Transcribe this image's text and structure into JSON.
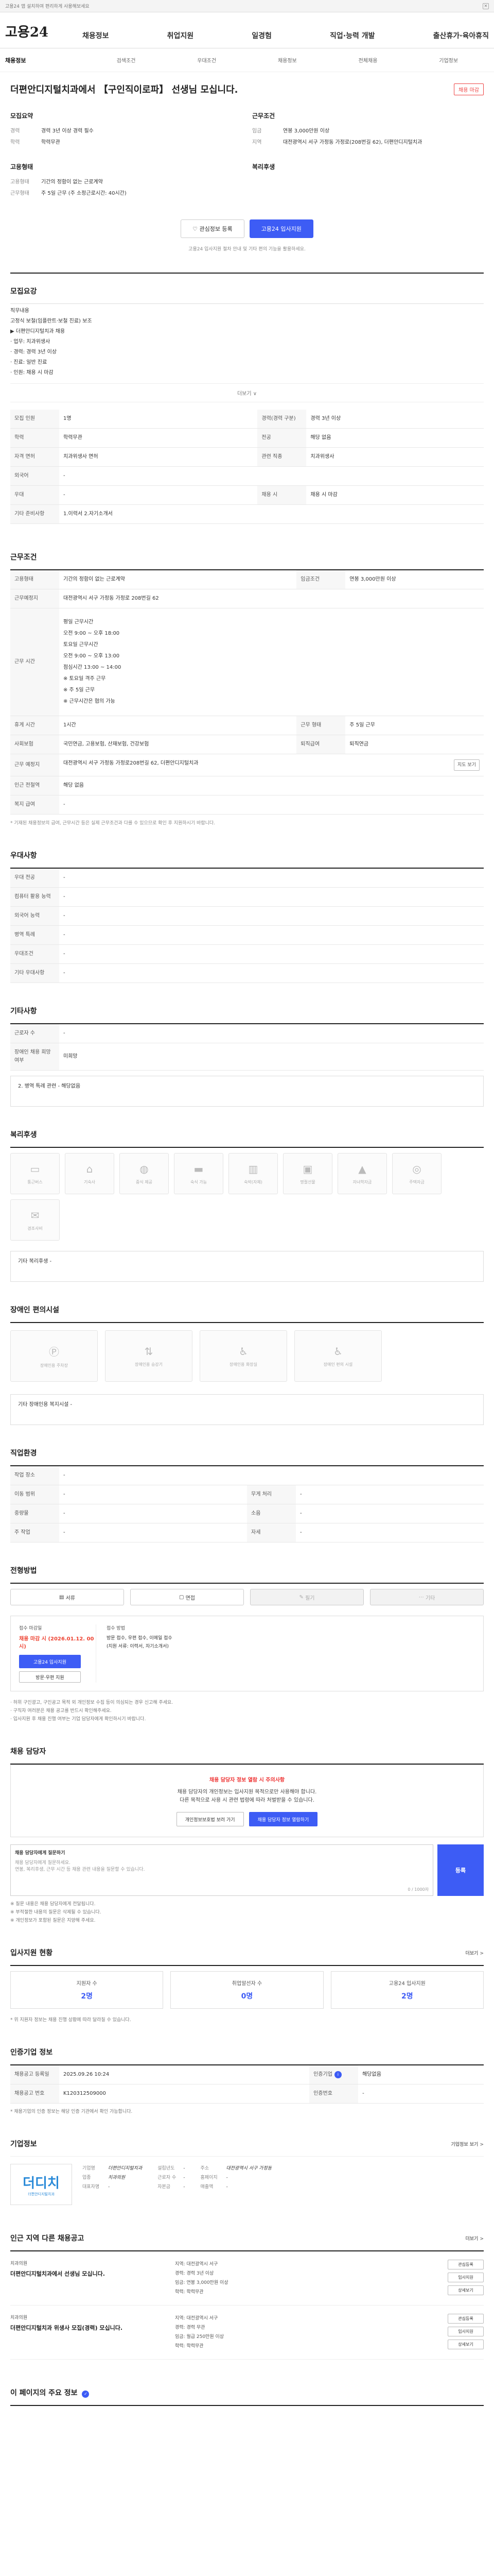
{
  "topbar": {
    "text": "고용24 앱 설치하여 편리하게 사용해보세요",
    "close": "×"
  },
  "header": {
    "logo": "고용24",
    "menu": [
      "채용정보",
      "취업지원",
      "일경험",
      "직업·능력 개발",
      "출산휴가·육아휴직"
    ]
  },
  "subnav": [
    "채용정보",
    "검색조건",
    "우대조건",
    "채용정보",
    "전체채용",
    "기업정보"
  ],
  "job": {
    "title": "더편안디지털치과에서 【구인직이로파】 선생님 모십니다.",
    "status": "채용 마감",
    "recruit_label": "모집요약",
    "cond_label": "근무조건",
    "recruit": [
      {
        "k": "경력",
        "v": "경력 3년 이상 경력 필수"
      },
      {
        "k": "학력",
        "v": "학력무관"
      }
    ],
    "cond": [
      {
        "k": "임금",
        "v": "연봉 3,000만원 이상"
      },
      {
        "k": "지역",
        "v": "대전광역시 서구 가정동 가정로(208번길 62), 더편안디지털치과"
      }
    ],
    "employ_label": "고용형태",
    "welfare_label": "복리후생",
    "employ": [
      {
        "k": "고용형태",
        "v": "기간의 정함이 없는 근로계약"
      },
      {
        "k": "근무형태",
        "v": "주 5일 근무 (주 소정근로시간: 40시간)"
      }
    ],
    "btn_apply_l": "관심정보 등록",
    "btn_apply_r": "고용24 입사지원",
    "notice": "고용24 입사지원 절차 안내 및 기타 편의 기능을 활용하세요."
  },
  "s1": {
    "title": "모집요강",
    "body": [
      "직무내용",
      "고정식 보철(임플란트·보철 진료) 보조",
      "▶ 더편안디지털치과 채용",
      "· 업무: 치과위생사",
      "· 경력: 경력 3년 이상",
      "· 진료: 일반 진료",
      "· 인원: 채용 시 마감"
    ],
    "more": "더보기 ∨",
    "rows": [
      [
        "모집 인원",
        "1명",
        "경력(경력 구분)",
        "경력 3년 이상"
      ],
      [
        "학력",
        "학력무관",
        "전공",
        "해당 없음"
      ],
      [
        "자격 면허",
        "치과위생사 면허",
        "관련 직종",
        "치과위생사"
      ],
      [
        "외국어",
        "-",
        "",
        ""
      ],
      [
        "우대",
        "-",
        "채용 시",
        "채용 시 마감"
      ]
    ],
    "etc_label": "기타 준비사항",
    "etc": "1.이력서 2.자기소개서"
  },
  "s2": {
    "title": "근무조건",
    "rows": [
      [
        "고용형태",
        "기간의 정함이 없는 근로계약",
        "임금조건",
        "연봉 3,000만원 이상"
      ],
      [
        "근무예정지",
        "대전광역시 서구 가정동 가정로 208번길 62",
        "",
        ""
      ]
    ],
    "shift_label": "근무 시간",
    "shift": [
      "평일 근무시간",
      "오전 9:00 ~ 오후 18:00",
      "토요일 근무시간",
      "오전 9:00 ~ 오후 13:00",
      "점심시간 13:00 ~ 14:00",
      "※ 토요일 격주 근무",
      "※ 주 5일 근무",
      "※ 근무시간은 협의 가능"
    ],
    "rows2": [
      [
        "휴게 시간",
        "1시간",
        "근무 형태",
        "주 5일 근무"
      ],
      [
        "사회보험",
        "국민연금, 고용보험, 산재보험, 건강보험",
        "퇴직급여",
        "퇴직연금"
      ],
      [
        "근무 예정지",
        "대전광역시 서구 가정동 가정로208번길 62, 더편안디지털치과",
        "",
        ""
      ],
      [
        "인근 전철역",
        "해당 없음",
        "",
        ""
      ],
      [
        "복지 급여",
        "-",
        "",
        ""
      ]
    ],
    "map_btn": "지도 보기",
    "disclaimer": "* 기재된 채용정보의 급여, 근무시간 등은 실제 근무조건과 다를 수 있으므로 확인 후 지원하시기 바랍니다."
  },
  "s3": {
    "title": "우대사항",
    "rows": [
      [
        "우대 전공",
        "-"
      ],
      [
        "컴퓨터 활용 능력",
        "-"
      ],
      [
        "외국어 능력",
        "-"
      ],
      [
        "병역 특례",
        "-"
      ],
      [
        "우대조건",
        "-"
      ],
      [
        "기타 우대사항",
        "-"
      ]
    ]
  },
  "s4": {
    "title": "기타사항",
    "rows": [
      [
        "근로자 수",
        "-"
      ],
      [
        "장애인 채용 희망 여부",
        "미희망"
      ]
    ],
    "box": "2. 병역 특례 관련 - 해당없음"
  },
  "s5": {
    "title": "복리후생",
    "items": [
      "통근버스",
      "기숙사",
      "중식 제공",
      "숙식 가능",
      "숙박(자체)",
      "명절선물",
      "자녀학자금",
      "주택자금",
      "경조사비"
    ],
    "box": "기타 복리후생 -"
  },
  "s6": {
    "title": "장애인 편의시설",
    "items": [
      "장애인용 주차장",
      "장애인용 승강기",
      "장애인용 화장실",
      "장애인 편의 시설"
    ],
    "box": "기타 장애인용 복지시설 -"
  },
  "s7": {
    "title": "직업환경",
    "rows": [
      [
        "작업 장소",
        "-",
        "",
        ""
      ],
      [
        "이동 범위",
        "-",
        "무게 처리",
        "-"
      ],
      [
        "중량물",
        "-",
        "소음",
        "-"
      ],
      [
        "주 작업",
        "-",
        "자세",
        "-"
      ]
    ]
  },
  "s8": {
    "title": "전형방법",
    "tabs": [
      "서류",
      "면접",
      "필기",
      "기타"
    ],
    "left_cap": "접수 마감일",
    "left_red": "채용 마감 시 (2026.01.12. 00시)",
    "l_btn1": "고용24 입사지원",
    "l_btn2": "방문·우편 지원",
    "right_cap": "접수 방법",
    "right_txt": "방문 접수, 우편 접수, 이메일 접수",
    "right_txt2": "(지원 서류: 이력서, 자기소개서)"
  },
  "bul": [
    "· 허위 구인광고, 구인공고 목적 외 개인정보 수집 등이 의심되는 경우 신고해 주세요.",
    "· 구직자 여러분은 채용 공고를 반드시 확인해주세요.",
    "· 입사지원 후 채용 진행 여부는 기업 담당자에게 확인하시기 바랍니다."
  ],
  "s9": {
    "title": "채용 담당자",
    "alert_red": "채용 담당자 정보 열람 시 주의사항",
    "alert_p": [
      "채용 담당자의 개인정보는 입사지원 목적으로만 사용해야 합니다.",
      "다른 목적으로 사용 시 관련 법령에 따라 처벌받을 수 있습니다."
    ],
    "btn1": "개인정보보호법 보러 가기",
    "btn2": "채용 담당자 정보 열람하기"
  },
  "s10": {
    "label": "채용 담당자에게 질문하기",
    "placeholder_b": "채용 담당자에게 질문하세요.",
    "placeholder": "연봉, 복리후생, 근무 시간 등 채용 관련 내용을 질문할 수 있습니다.",
    "count": "0 / 1000자",
    "submit": "등록",
    "notes": [
      "※ 질문 내용은 채용 담당자에게 전달됩니다.",
      "※ 부적절한 내용의 질문은 삭제될 수 있습니다.",
      "※ 개인정보가 포함된 질문은 지양해 주세요."
    ]
  },
  "s11": {
    "title": "입사지원 현황",
    "more": "더보기 >",
    "stats": [
      {
        "k": "지원자 수",
        "v": "2명"
      },
      {
        "k": "취업알선자 수",
        "v": "0명"
      },
      {
        "k": "고용24 입사지원",
        "v": "2명"
      }
    ],
    "note": "* 위 지원자 정보는 채용 진행 상황에 따라 달라질 수 있습니다."
  },
  "s12": {
    "title": "인증기업 정보",
    "rows": [
      [
        "채용공고 등록일",
        "2025.09.26 10:24",
        "인증기업",
        "해당없음"
      ],
      [
        "채용공고 번호",
        "K120312509000",
        "인증번호",
        "-"
      ]
    ],
    "note": "* 채용기업의 인증 정보는 해당 인증 기관에서 확인 가능합니다."
  },
  "s13": {
    "title": "기업정보",
    "more": "기업정보 보기 >",
    "logo": "더디치",
    "logo_sub": "더편안디지털치과",
    "cols": [
      [
        [
          "기업명",
          "더편안디지털치과"
        ],
        [
          "업종",
          "치과의원"
        ],
        [
          "대표자명",
          "-"
        ]
      ],
      [
        [
          "설립년도",
          "-"
        ],
        [
          "근로자 수",
          "-"
        ],
        [
          "자본금",
          "-"
        ]
      ],
      [
        [
          "주소",
          "대전광역시 서구 가정동"
        ],
        [
          "홈페이지",
          "-"
        ],
        [
          "매출액",
          "-"
        ]
      ]
    ]
  },
  "s14": {
    "title": "인근 지역 다른 채용공고",
    "more": "더보기 >",
    "recs": [
      {
        "co": "치과의원",
        "title": "더편안디지털치과에서 선생님 모십니다.",
        "info": [
          "지역: 대전광역시 서구",
          "경력: 경력 3년 이상",
          "임금: 연봉 3,000만원 이상",
          "학력: 학력무관"
        ],
        "btns": [
          "관심등록",
          "입사지원",
          "상세보기"
        ]
      },
      {
        "co": "치과의원",
        "title": "더편안디지털치과 위생사 모집(경력) 모십니다.",
        "info": [
          "지역: 대전광역시 서구",
          "경력: 경력 무관",
          "임금: 월급 250만원 이상",
          "학력: 학력무관"
        ],
        "btns": [
          "관심등록",
          "입사지원",
          "상세보기"
        ]
      }
    ]
  },
  "s15": {
    "title": "이 페이지의 주요 정보",
    "icon": "✓"
  }
}
